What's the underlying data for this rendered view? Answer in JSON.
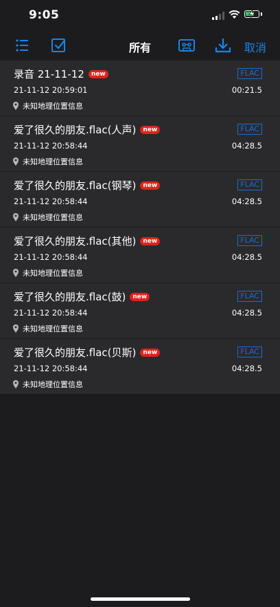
{
  "status": {
    "time": "9:05"
  },
  "toolbar": {
    "title": "所有",
    "cancel_label": "取消",
    "accent_color": "#1a84e8"
  },
  "recordings": [
    {
      "title": "录音 21-11-12",
      "badge": "new",
      "format": "FLAC",
      "date": "21-11-12 20:59:01",
      "duration": "00:21.5",
      "location": "未知地理位置信息"
    },
    {
      "title": "爱了很久的朋友.flac(人声)",
      "badge": "new",
      "format": "FLAC",
      "date": "21-11-12 20:58:44",
      "duration": "04:28.5",
      "location": "未知地理位置信息"
    },
    {
      "title": "爱了很久的朋友.flac(钢琴)",
      "badge": "new",
      "format": "FLAC",
      "date": "21-11-12 20:58:44",
      "duration": "04:28.5",
      "location": "未知地理位置信息"
    },
    {
      "title": "爱了很久的朋友.flac(其他)",
      "badge": "new",
      "format": "FLAC",
      "date": "21-11-12 20:58:44",
      "duration": "04:28.5",
      "location": "未知地理位置信息"
    },
    {
      "title": "爱了很久的朋友.flac(鼓)",
      "badge": "new",
      "format": "FLAC",
      "date": "21-11-12 20:58:44",
      "duration": "04:28.5",
      "location": "未知地理位置信息"
    },
    {
      "title": "爱了很久的朋友.flac(贝斯)",
      "badge": "new",
      "format": "FLAC",
      "date": "21-11-12 20:58:44",
      "duration": "04:28.5",
      "location": "未知地理位置信息"
    }
  ]
}
